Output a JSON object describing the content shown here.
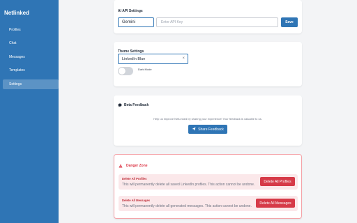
{
  "sidebar": {
    "brand": "Netlinked",
    "items": [
      {
        "label": "Profiles",
        "active": false
      },
      {
        "label": "Chat",
        "active": false
      },
      {
        "label": "Messages",
        "active": false
      },
      {
        "label": "Templates",
        "active": false
      },
      {
        "label": "Settings",
        "active": true
      }
    ]
  },
  "ai_settings": {
    "title": "AI API Settings",
    "provider": "Gemini",
    "api_key_placeholder": "Enter API Key",
    "api_key_value": "",
    "save_label": "Save"
  },
  "theme_settings": {
    "title": "Theme Settings",
    "selected_theme": "LinkedIn Blue",
    "clear_symbol": "×",
    "dark_mode_label": "Dark Mode",
    "dark_mode_on": false
  },
  "beta_feedback": {
    "icon": "chat-bubble-icon",
    "title": "Beta Feedback",
    "text": "Help us improve NetLinked by sharing your experience! Your feedback is valuable to us.",
    "button_label": "Share Feedback"
  },
  "danger_zone": {
    "title": "Danger Zone",
    "items": [
      {
        "title": "Delete All Profiles",
        "description": "This will permanently delete all saved LinkedIn profiles. This action cannot be undone.",
        "button_label": "Delete All Profiles"
      },
      {
        "title": "Delete All Messages",
        "description": "This will permanently delete all generated messages. This action cannot be undone.",
        "button_label": "Delete All Messages"
      }
    ]
  },
  "colors": {
    "primary": "#2f75b5",
    "danger": "#d63a48",
    "danger_bg": "#fbe8ea",
    "page_bg": "#f3f4f6"
  }
}
